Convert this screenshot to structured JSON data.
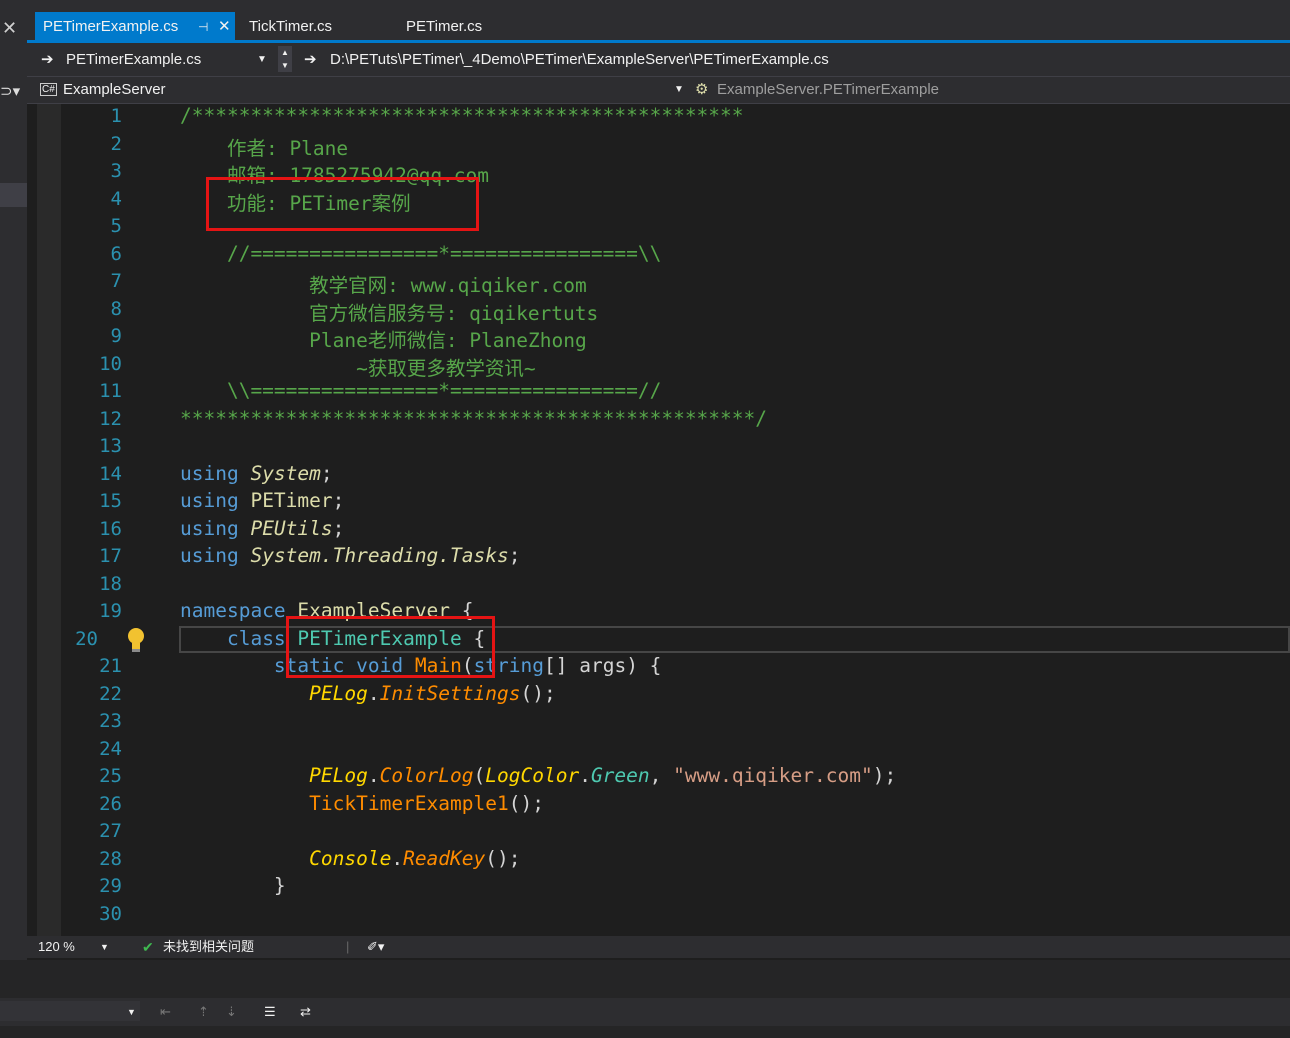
{
  "tabs": [
    {
      "label": "PETimerExample.cs",
      "active": true
    },
    {
      "label": "TickTimer.cs",
      "active": false
    },
    {
      "label": "PETimer.cs",
      "active": false
    }
  ],
  "nav1": {
    "file": "PETimerExample.cs",
    "path": "D:\\PETuts\\PETimer\\_4Demo\\PETimer\\ExampleServer\\PETimerExample.cs"
  },
  "nav2": {
    "project": "ExampleServer",
    "member": "ExampleServer.PETimerExample"
  },
  "line_numbers": [
    "1",
    "2",
    "3",
    "4",
    "5",
    "6",
    "7",
    "8",
    "9",
    "10",
    "11",
    "12",
    "13",
    "14",
    "15",
    "16",
    "17",
    "18",
    "19",
    "20",
    "21",
    "22",
    "23",
    "24",
    "25",
    "26",
    "27",
    "28",
    "29",
    "30"
  ],
  "code": {
    "l1": "/***********************************************",
    "l2": "    作者: Plane",
    "l3": "    邮箱: 1785275942@qq.com",
    "l4": "    功能: PETimer案例",
    "l6": "    //================*================\\\\",
    "l7": "           教学官网: www.qiqiker.com",
    "l8": "           官方微信服务号: qiqikertuts",
    "l9": "           Plane老师微信: PlaneZhong",
    "l10": "               ~获取更多教学资讯~",
    "l11": "    \\\\================*================//",
    "l12": "*************************************************/",
    "l14_kw": "using",
    "l14_ns": "System",
    "l15_kw": "using",
    "l15_ns": "PETimer",
    "l16_kw": "using",
    "l16_ns": "PEUtils",
    "l17_kw": "using",
    "l17_ns": "System.Threading.Tasks",
    "l19_kw": "namespace",
    "l19_name": "ExampleServer",
    "l20_kw": "class",
    "l20_name": "PETimerExample",
    "l21_kw1": "static",
    "l21_kw2": "void",
    "l21_fn": "Main",
    "l21_kw3": "string",
    "l21_arg": "[] args) {",
    "l22_cls": "PELog",
    "l22_fn": "InitSettings",
    "l25_cls": "PELog",
    "l25_fn": "ColorLog",
    "l25_arg1": "LogColor",
    "l25_arg2": "Green",
    "l25_str": "\"www.qiqiker.com\"",
    "l26_fn": "TickTimerExample1",
    "l28_cls": "Console",
    "l28_fn": "ReadKey",
    "l29": "        }"
  },
  "status": {
    "zoom": "120 %",
    "issues": "未找到相关问题"
  }
}
